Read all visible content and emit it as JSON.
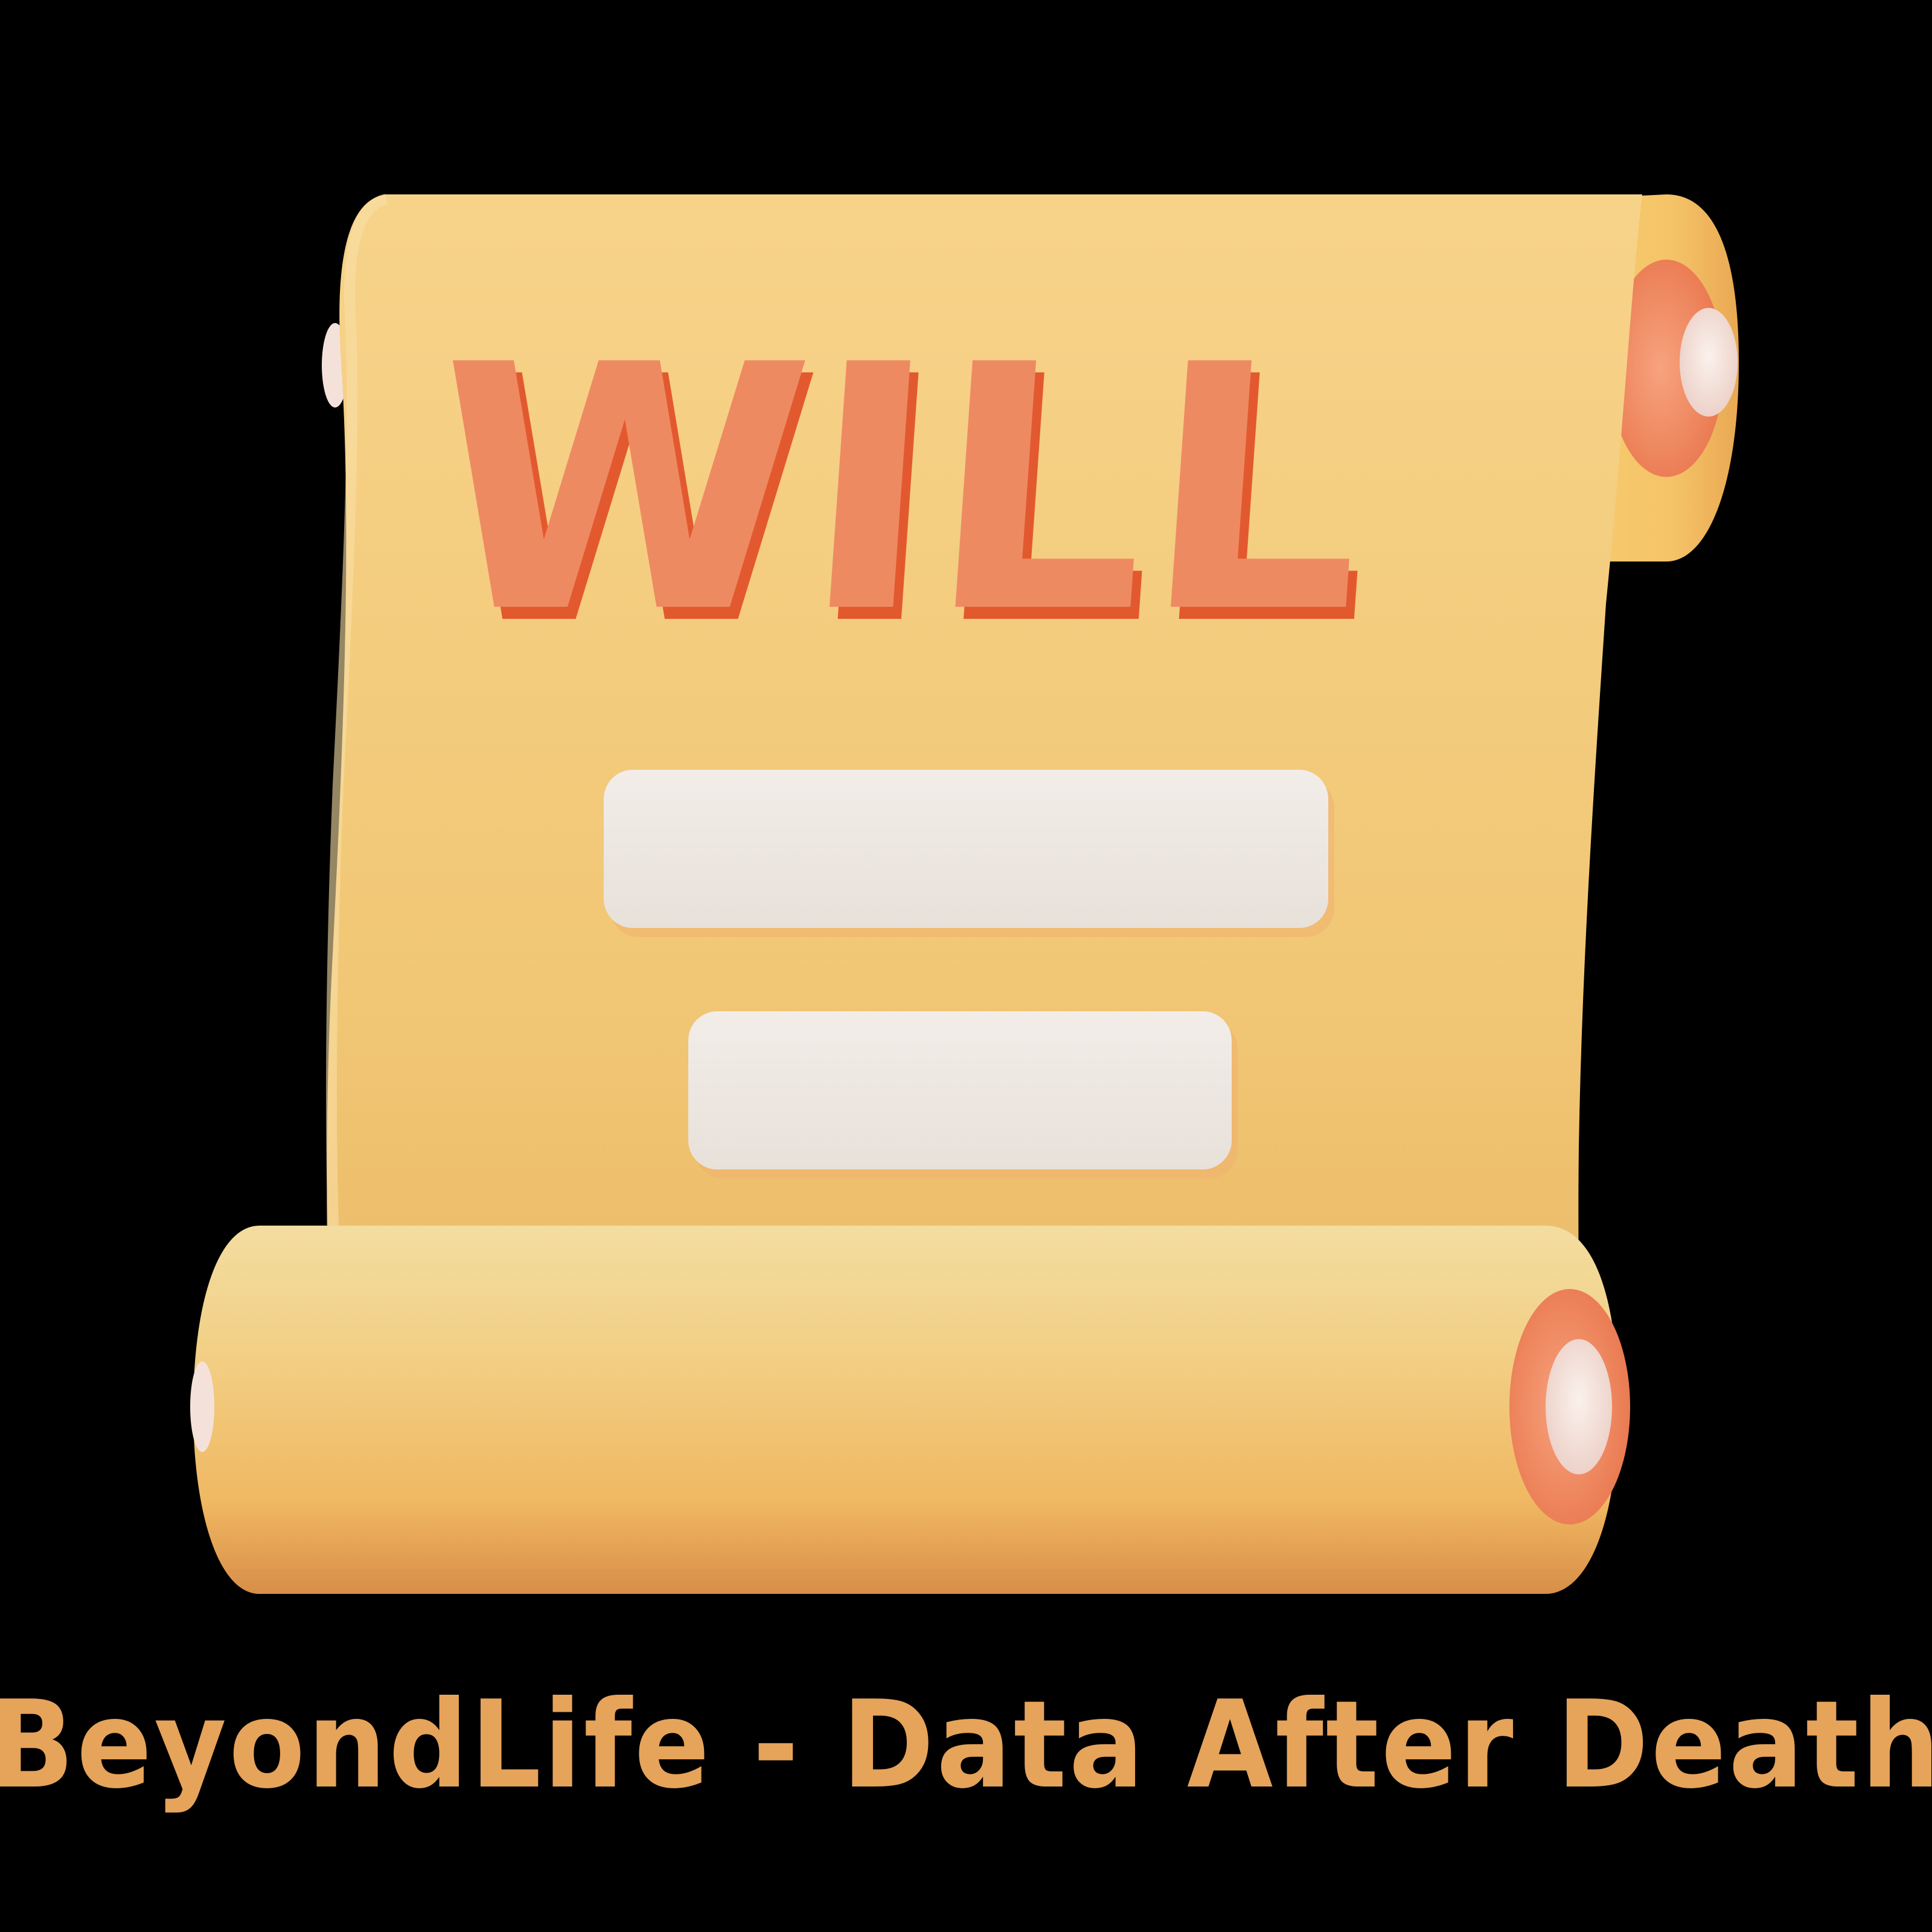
{
  "heading": "WILL",
  "caption": "BeyondLife - Data After Death",
  "colors": {
    "background": "#000000",
    "parchment": "#F2C878",
    "parchment_light": "#F6DCA0",
    "letter": "#EE8A60",
    "letter_shadow": "#E3592F",
    "bar": "#EEE8E2",
    "roller_cap": "#F0906A",
    "knob": "#F4E4DE",
    "caption": "#E6A35A"
  }
}
